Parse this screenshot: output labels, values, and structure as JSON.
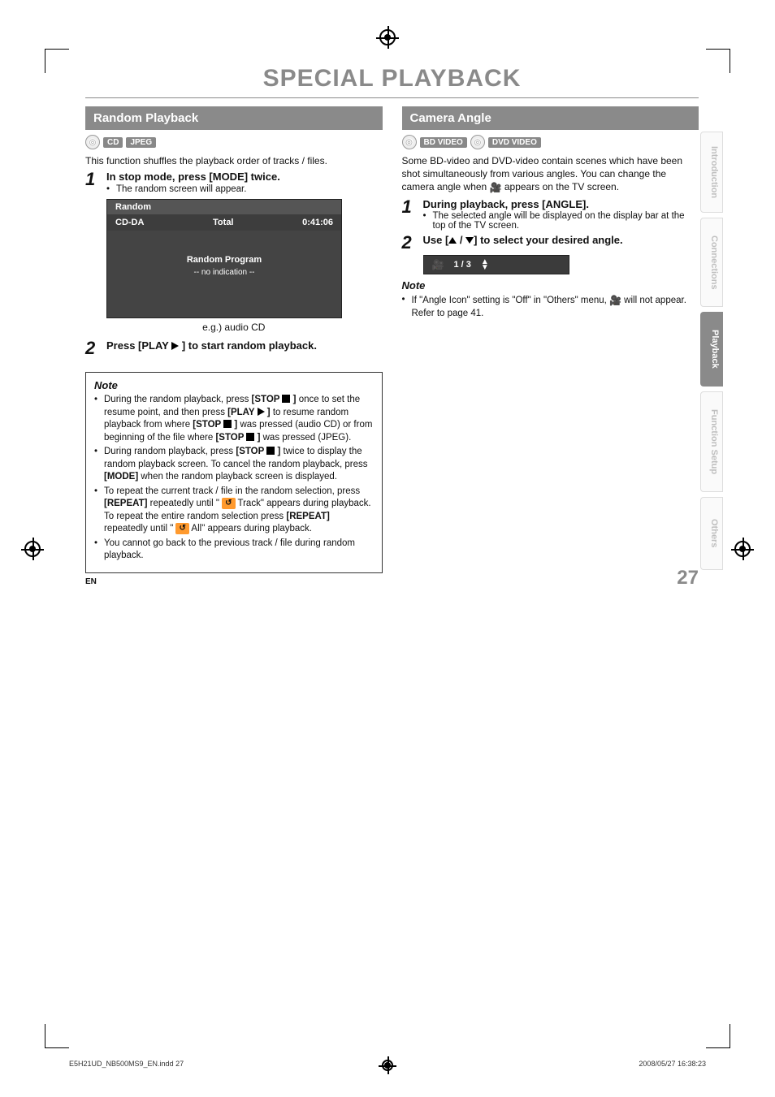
{
  "title": "SPECIAL PLAYBACK",
  "left": {
    "heading": "Random Playback",
    "badges": [
      "CD",
      "JPEG"
    ],
    "intro": "This function shuffles the playback order of tracks / files.",
    "step1": {
      "num": "1",
      "main": "In stop mode, press [MODE] twice.",
      "sub": "The random screen will appear."
    },
    "osd": {
      "title": "Random",
      "label_left": "CD-DA",
      "label_mid": "Total",
      "label_right": "0:41:06",
      "body1": "Random Program",
      "body2": "-- no indication --"
    },
    "caption": "e.g.) audio CD",
    "step2": {
      "num": "2",
      "main_a": "Press [PLAY ",
      "main_b": " ] to start random playback."
    },
    "note_heading": "Note",
    "notes": [
      {
        "a": "During the random playback, press ",
        "b": "[STOP ",
        "c": " ]",
        "d": " once to set the resume point, and then press ",
        "e": "[PLAY ",
        "f": " ]",
        "g": " to resume random playback from where ",
        "h": "[STOP ",
        "i": " ]",
        "j": " was pressed (audio CD) or from beginning of the file where ",
        "k": "[STOP ",
        "l": " ]",
        "m": " was pressed (JPEG)."
      },
      {
        "a": "During random playback, press ",
        "b": "[STOP ",
        "c": " ]",
        "d": " twice to display the random playback screen. To cancel the random playback, press ",
        "e": "[MODE]",
        "f": " when the random playback screen is displayed."
      },
      {
        "a": "To repeat the current track / file in the random selection, press ",
        "b": "[REPEAT]",
        "c": " repeatedly until \" ",
        "d": " Track\" appears during playback. To repeat the entire random selection press ",
        "e": "[REPEAT]",
        "f": " repeatedly until \" ",
        "g": " All\" appears during playback."
      },
      {
        "a": "You cannot go back to the previous track / file during random playback."
      }
    ]
  },
  "right": {
    "heading": "Camera Angle",
    "badges": [
      "BD VIDEO",
      "DVD VIDEO"
    ],
    "intro_a": "Some BD-video and DVD-video contain scenes which have been shot simultaneously from various angles. You can change the camera angle when ",
    "intro_b": " appears on the TV screen.",
    "step1": {
      "num": "1",
      "main": "During playback, press [ANGLE].",
      "sub": "The selected angle will be displayed on the display bar at the top of the TV screen."
    },
    "step2": {
      "num": "2",
      "main_a": "Use [",
      "main_b": " / ",
      "main_c": "] to select your desired angle."
    },
    "angle_bar": {
      "count": "1 / 3"
    },
    "note_heading": "Note",
    "note": {
      "a": "If \"Angle Icon\" setting is \"Off\" in \"Others\" menu, ",
      "b": " will not appear. Refer to page 41."
    }
  },
  "tabs": {
    "intro": "Introduction",
    "conn": "Connections",
    "play": "Playback",
    "func": "Function Setup",
    "oth": "Others"
  },
  "page": {
    "num": "27",
    "en": "EN"
  },
  "footer": {
    "left": "E5H21UD_NB500MS9_EN.indd   27",
    "right": "2008/05/27   16:38:23"
  }
}
